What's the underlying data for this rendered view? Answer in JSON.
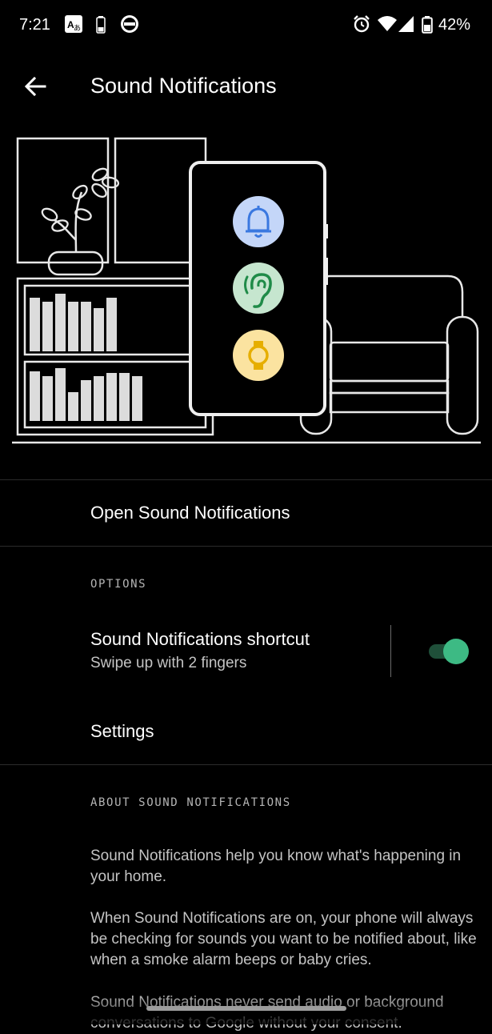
{
  "status_bar": {
    "time": "7:21",
    "battery_percent": "42%",
    "icons": [
      "translate-icon",
      "battery-small-icon",
      "app-badge-icon",
      "alarm-icon",
      "wifi-icon",
      "cell-signal-icon",
      "battery-icon"
    ]
  },
  "app_bar": {
    "title": "Sound Notifications",
    "back_icon": "arrow-back-icon"
  },
  "illustration": {
    "icons": [
      "bell-icon",
      "ear-icon",
      "watch-icon"
    ],
    "colors": {
      "bell_bg": "#c4d6f8",
      "bell_fg": "#3a78e0",
      "ear_bg": "#c6e6cf",
      "ear_fg": "#1f8b48",
      "watch_bg": "#fbe3a0",
      "watch_fg": "#e6ae00"
    }
  },
  "menu": {
    "open_label": "Open Sound Notifications",
    "options_header": "OPTIONS",
    "shortcut": {
      "title": "Sound Notifications shortcut",
      "subtitle": "Swipe up with 2 fingers",
      "enabled": true
    },
    "settings_label": "Settings"
  },
  "about": {
    "header": "ABOUT SOUND NOTIFICATIONS",
    "paragraphs": [
      "Sound Notifications help you know what's happening in your home.",
      "When Sound Notifications are on, your phone will always be checking for sounds you want to be notified about, like when a smoke alarm beeps or baby cries.",
      "Sound Notifications never send audio or background conversations to Google without your consent."
    ]
  },
  "colors": {
    "background": "#000000",
    "toggle_on": "#3dba84",
    "toggle_track": "#1f4f39"
  }
}
